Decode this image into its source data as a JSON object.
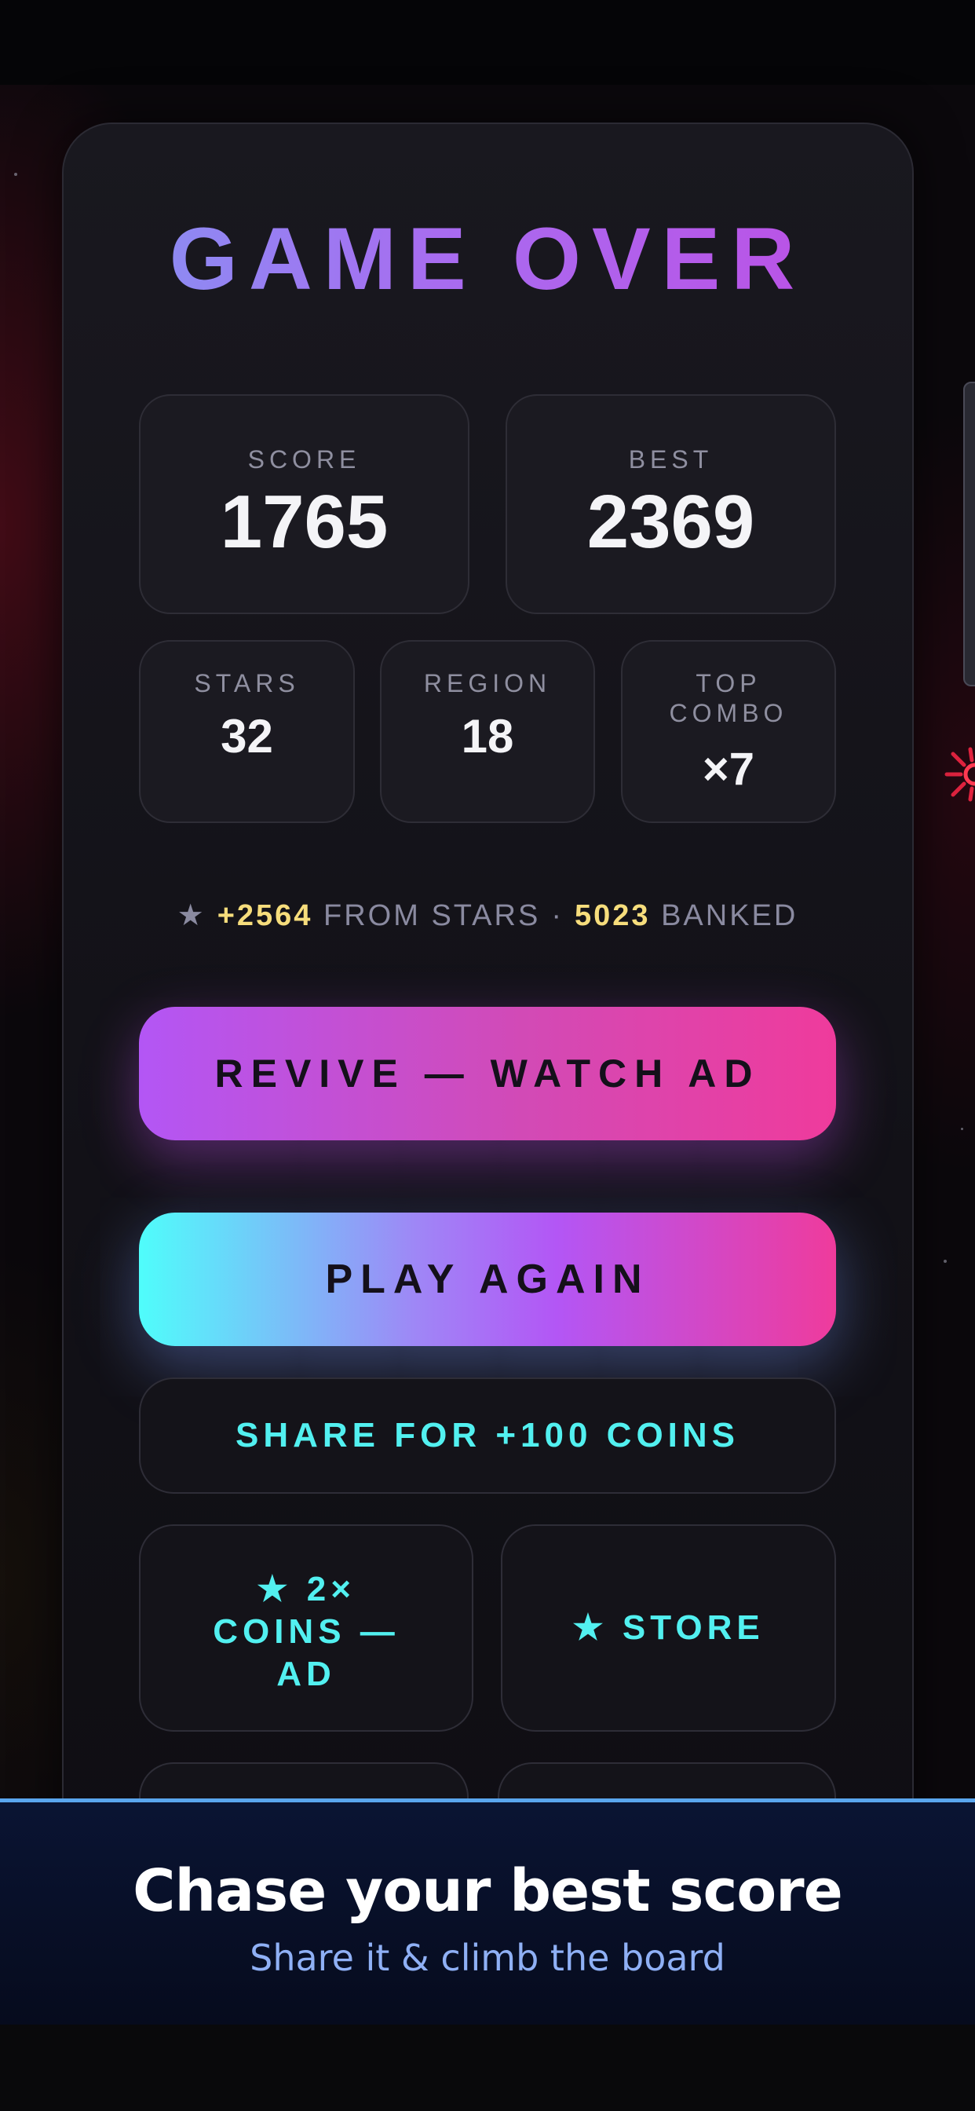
{
  "game_over": {
    "title": "GAME OVER",
    "score": {
      "label": "SCORE",
      "value": "1765"
    },
    "best": {
      "label": "BEST",
      "value": "2369"
    },
    "stars": {
      "label": "STARS",
      "value": "32"
    },
    "region": {
      "label": "REGION",
      "value": "18"
    },
    "top_combo": {
      "label_line1": "TOP",
      "label_line2": "COMBO",
      "value": "×7"
    },
    "coins_summary": {
      "star_glyph": "★",
      "from_stars_amount": "+2564",
      "from_stars_text": "FROM STARS",
      "separator": "·",
      "banked_amount": "5023",
      "banked_text": "BANKED"
    },
    "buttons": {
      "revive": "REVIVE — WATCH AD",
      "play_again": "PLAY AGAIN",
      "share": "SHARE FOR +100 COINS",
      "double_coins_line1": "★ 2×",
      "double_coins_line2": "COINS —",
      "double_coins_line3": "AD",
      "store": "★ STORE"
    }
  },
  "promo_banner": {
    "title": "Chase your best score",
    "subtitle": "Share it & climb the board"
  },
  "colors": {
    "title_gradient": [
      "#7e9cf4",
      "#c248e2"
    ],
    "revive_gradient": [
      "#b356f5",
      "#ef3b9c"
    ],
    "play_gradient": [
      "#4ffdfb",
      "#b356f5",
      "#ef3b9c"
    ],
    "accent_cyan": "#52f0f0",
    "coin_gold": "#f6dd7c",
    "banner_border": "#5aa6ee"
  },
  "icons": [
    "star-icon",
    "spark-icon"
  ]
}
